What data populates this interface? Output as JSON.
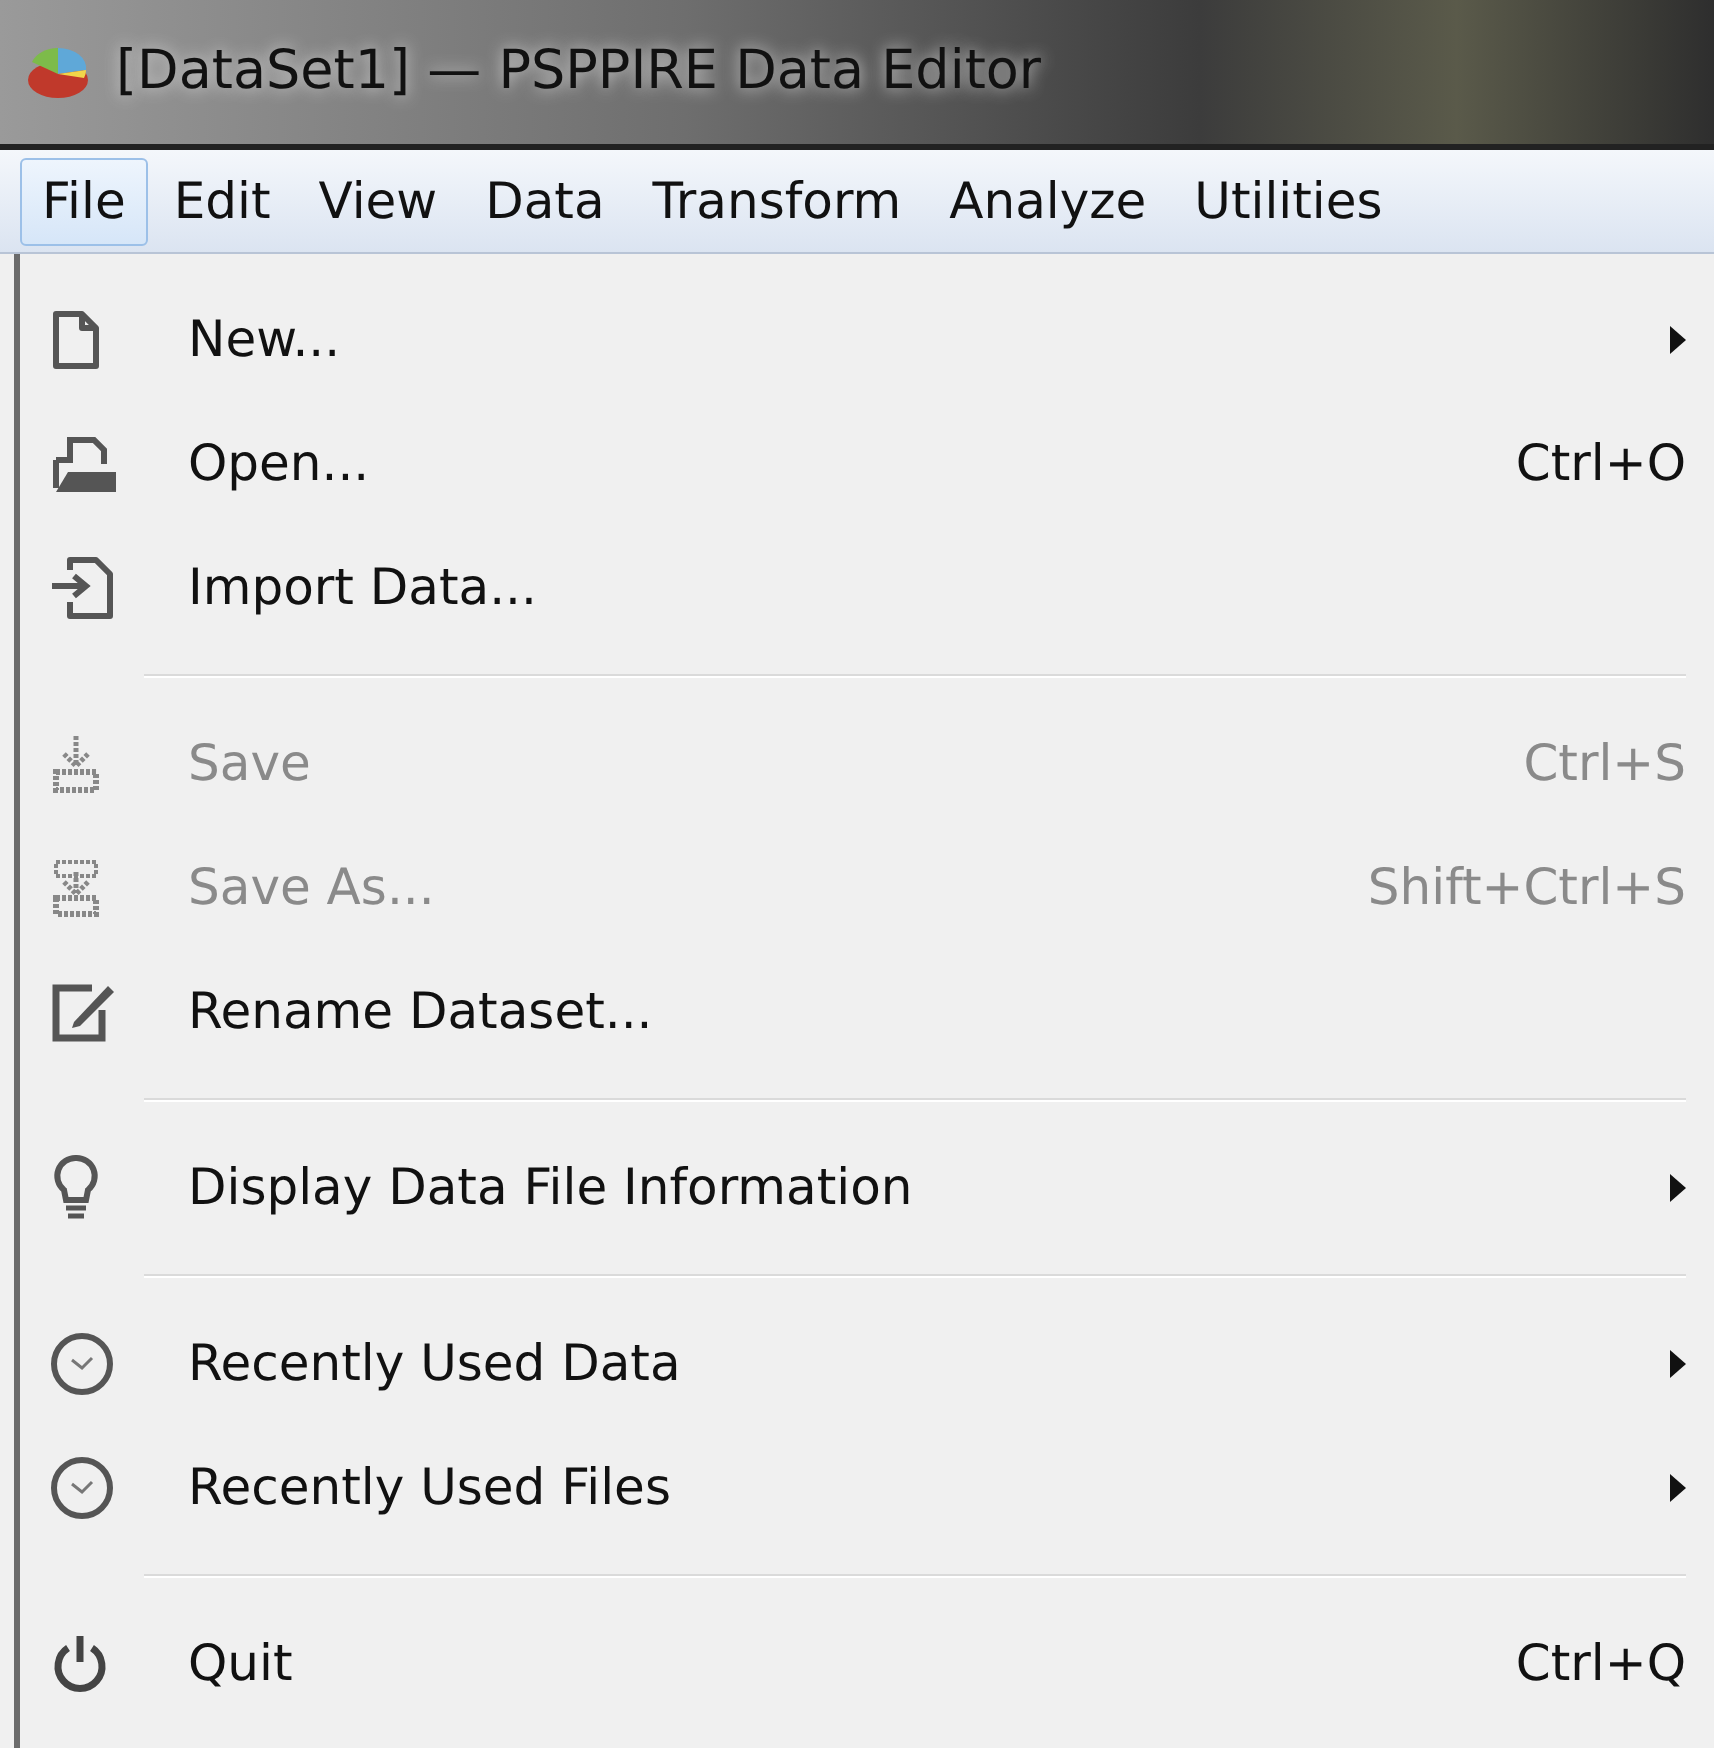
{
  "window": {
    "title": "[DataSet1] — PSPPIRE Data Editor"
  },
  "menubar": [
    {
      "label": "File",
      "selected": true
    },
    {
      "label": "Edit",
      "selected": false
    },
    {
      "label": "View",
      "selected": false
    },
    {
      "label": "Data",
      "selected": false
    },
    {
      "label": "Transform",
      "selected": false
    },
    {
      "label": "Analyze",
      "selected": false
    },
    {
      "label": "Utilities",
      "selected": false
    }
  ],
  "file_menu": [
    {
      "kind": "item",
      "label": "New...",
      "disabled": false,
      "submenu": true
    },
    {
      "kind": "item",
      "label": "Open...",
      "shortcut": "Ctrl+O",
      "disabled": false,
      "submenu": false
    },
    {
      "kind": "item",
      "label": "Import Data...",
      "disabled": false,
      "submenu": false
    },
    {
      "kind": "separator"
    },
    {
      "kind": "item",
      "label": "Save",
      "shortcut": "Ctrl+S",
      "disabled": true,
      "submenu": false
    },
    {
      "kind": "item",
      "label": "Save As...",
      "shortcut": "Shift+Ctrl+S",
      "disabled": true,
      "submenu": false
    },
    {
      "kind": "item",
      "label": "Rename Dataset...",
      "disabled": false,
      "submenu": false
    },
    {
      "kind": "separator"
    },
    {
      "kind": "item",
      "label": "Display Data File Information",
      "disabled": false,
      "submenu": true
    },
    {
      "kind": "separator"
    },
    {
      "kind": "item",
      "label": "Recently Used Data",
      "disabled": false,
      "submenu": true
    },
    {
      "kind": "item",
      "label": "Recently Used Files",
      "disabled": false,
      "submenu": true
    },
    {
      "kind": "separator"
    },
    {
      "kind": "item",
      "label": "Quit",
      "shortcut": "Ctrl+Q",
      "disabled": false,
      "submenu": false
    }
  ]
}
